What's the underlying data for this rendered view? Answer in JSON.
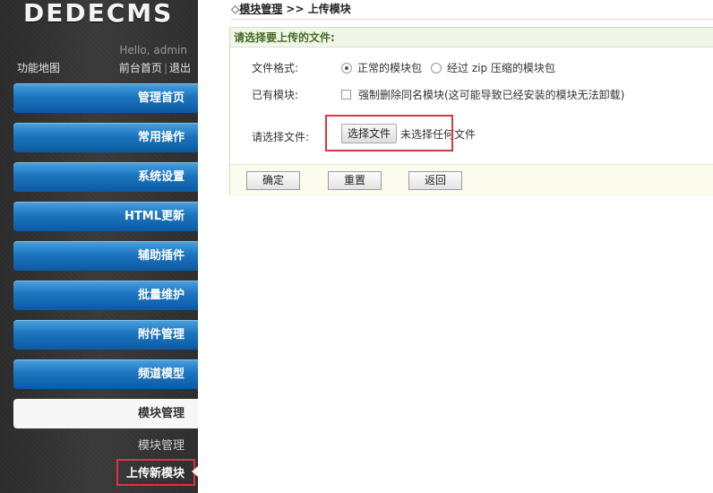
{
  "sidebar": {
    "logo": "DEDECMS",
    "hello": "Hello, admin",
    "func_map": "功能地图",
    "top_links": {
      "home": "前台首页",
      "separator": "|",
      "logout": "退出"
    },
    "menu": [
      {
        "label": "管理首页"
      },
      {
        "label": "常用操作"
      },
      {
        "label": "系统设置"
      },
      {
        "label": "HTML更新"
      },
      {
        "label": "辅助插件"
      },
      {
        "label": "批量维护"
      },
      {
        "label": "附件管理"
      },
      {
        "label": "频道模型"
      },
      {
        "label": "模块管理",
        "active": true
      }
    ],
    "sub_items": [
      {
        "label": "模块管理"
      },
      {
        "label": "上传新模块",
        "current": true
      }
    ]
  },
  "main": {
    "breadcrumb": {
      "prefix": "◇",
      "link": "模块管理",
      "separator": " >> ",
      "current": "上传模块"
    },
    "panel_title": "请选择要上传的文件:",
    "format": {
      "label": "文件格式:",
      "options": [
        {
          "label": "正常的模块包",
          "checked": true
        },
        {
          "label": "经过 zip 压缩的模块包",
          "checked": false
        }
      ]
    },
    "existing": {
      "label": "已有模块:",
      "checkbox_label": "强制删除同名模块(这可能导致已经安装的模块无法卸载)"
    },
    "file": {
      "label": "请选择文件:",
      "button": "选择文件",
      "status": "未选择任何文件"
    },
    "actions": {
      "confirm": "确定",
      "reset": "重置",
      "back": "返回"
    }
  },
  "colors": {
    "highlight_border": "#d9363e",
    "menu_blue": "#1d75bf",
    "panel_title": "#456b22"
  }
}
